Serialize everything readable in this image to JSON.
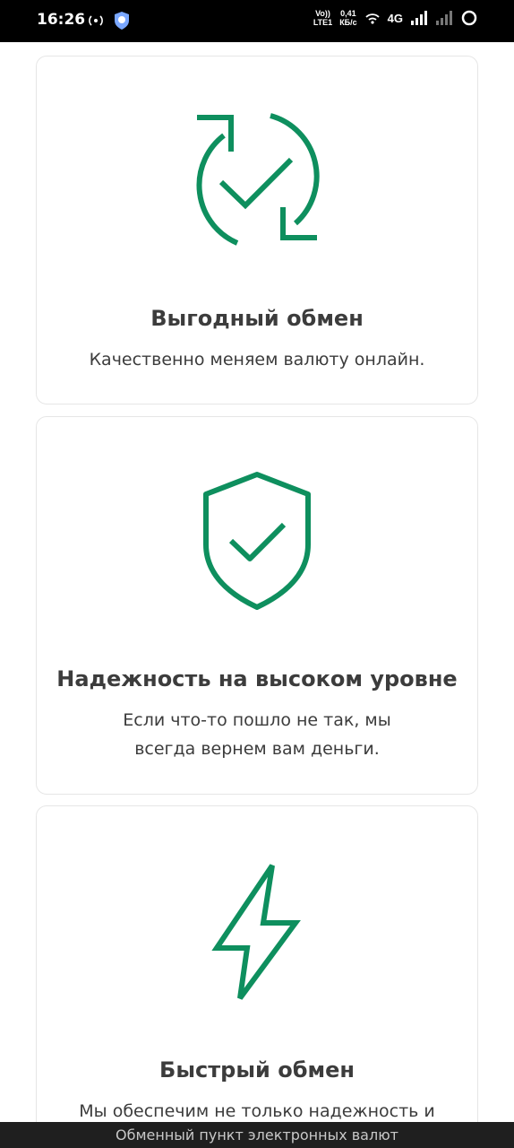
{
  "status_bar": {
    "time": "16:26",
    "network_speed_value": "0,41",
    "network_speed_unit": "КБ/с",
    "volte": "Vo))",
    "lte": "LTE1",
    "network_type": "4G"
  },
  "cards": [
    {
      "icon": "refresh-check-icon",
      "title": "Выгодный обмен",
      "text": "Качественно меняем валюту онлайн."
    },
    {
      "icon": "shield-check-icon",
      "title": "Надежность на высоком уровне",
      "text": "Если что-то пошло не так, мы всегда вернем вам деньги."
    },
    {
      "icon": "lightning-icon",
      "title": "Быстрый обмен",
      "text": "Мы обеспечим не только надежность и"
    }
  ],
  "bottom_bar": {
    "text": "Обменный пункт электронных валют"
  },
  "colors": {
    "accent": "#0e8f5e",
    "text": "#3c3c3c",
    "border": "#e6e6e6"
  }
}
